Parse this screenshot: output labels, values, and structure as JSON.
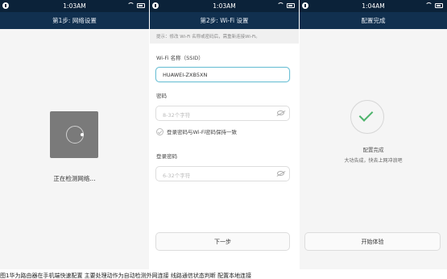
{
  "screens": [
    {
      "status": {
        "time": "1:03AM"
      },
      "title": "第1步: 网络设置",
      "detecting_text": "正在检测网络..."
    },
    {
      "status": {
        "time": "1:03AM"
      },
      "title": "第2步: Wi-Fi 设置",
      "hint": "提示：修改 Wi-Fi 名称或密码后，需重新连接Wi-Fi。",
      "ssid_label": "Wi-Fi 名称（SSID）",
      "ssid_value": "HUAWEI-ZXB5XN",
      "password_label": "密码",
      "password_placeholder": "8-32个字符",
      "same_password_label": "登录密码与Wi-Fi密码保持一致",
      "login_password_label": "登录密码",
      "login_password_placeholder": "6-32个字符",
      "next_button": "下一步"
    },
    {
      "status": {
        "time": "1:04AM"
      },
      "title": "配置完成",
      "done_title": "配置完成",
      "done_subtitle": "大功告成，快去上网冲浪吧",
      "start_button": "开始体验"
    }
  ],
  "caption": "图1华为路由器在手机端快速配置 主要处理动作为自动检测外网连接 线路通信状态判断 配置本地连接"
}
